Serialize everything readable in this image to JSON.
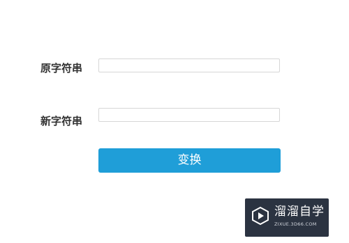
{
  "form": {
    "original_label": "原字符串",
    "original_value": "",
    "new_label": "新字符串",
    "new_value": "",
    "submit_label": "变换"
  },
  "colors": {
    "button_bg": "#1f9ed8",
    "button_text": "#ffffff",
    "label_text": "#333333",
    "input_border": "#d6d6d6"
  },
  "watermark": {
    "title": "溜溜自学",
    "subtitle": "ZIXUE.3D66.COM",
    "logo_icon": "play-shield-icon"
  }
}
